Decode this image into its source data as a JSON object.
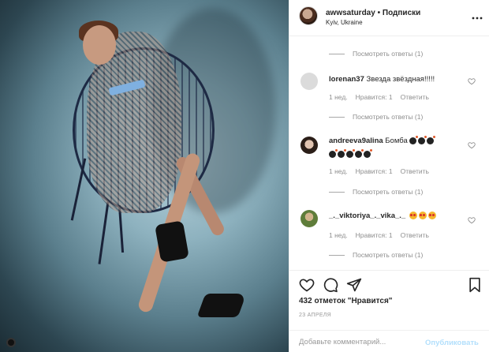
{
  "post": {
    "username": "awwsaturday",
    "separator": " • ",
    "follow_label": "Подписки",
    "location": "Kyiv, Ukraine"
  },
  "replies_label": "Посмотреть ответы (1)",
  "comments": [
    {
      "username": "lorenan37",
      "text": "Звезда звёздная!!!!!",
      "time": "1 нед.",
      "likes": "Нравится: 1",
      "reply": "Ответить"
    },
    {
      "username": "andreeva9alina",
      "text": "Бомба",
      "emoji": "bomb",
      "time": "1 нед.",
      "likes": "Нравится: 1",
      "reply": "Ответить"
    },
    {
      "username": "_._viktoriya_._vika_._",
      "text": "",
      "emoji": "star-struck",
      "time": "1 нед.",
      "likes": "Нравится: 1",
      "reply": "Ответить"
    }
  ],
  "actions": {
    "like_icon": "heart-outline-icon",
    "comment_icon": "comment-bubble-icon",
    "share_icon": "paper-plane-icon",
    "save_icon": "bookmark-icon"
  },
  "likes_text": "432 отметок \"Нравится\"",
  "date_text": "23 АПРЕЛЯ",
  "comment_box": {
    "placeholder": "Добавьте комментарий...",
    "publish_label": "Опубликовать"
  },
  "colors": {
    "text": "#262626",
    "muted": "#8e8e8e",
    "publish_disabled": "#b2dffc",
    "border": "#efefef"
  }
}
